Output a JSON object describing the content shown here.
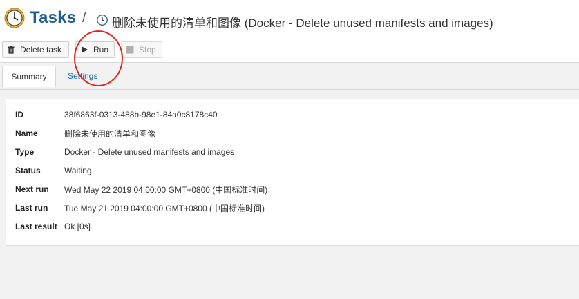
{
  "header": {
    "app_title": "Tasks",
    "separator": "/",
    "task_title": "删除未使用的清单和图像 (Docker - Delete unused manifests and images)",
    "app_icon": "clock-icon",
    "task_icon": "small-clock-icon"
  },
  "toolbar": {
    "delete_label": "Delete task",
    "run_label": "Run",
    "stop_label": "Stop"
  },
  "tabs": [
    {
      "label": "Summary",
      "active": true
    },
    {
      "label": "Settings",
      "active": false
    }
  ],
  "details": [
    {
      "key": "ID",
      "value": "38f6863f-0313-488b-98e1-84a0c8178c40"
    },
    {
      "key": "Name",
      "value": "删除未使用的清单和图像"
    },
    {
      "key": "Type",
      "value": "Docker - Delete unused manifests and images"
    },
    {
      "key": "Status",
      "value": "Waiting"
    },
    {
      "key": "Next run",
      "value": "Wed May 22 2019 04:00:00 GMT+0800 (中国标准时间)"
    },
    {
      "key": "Last run",
      "value": "Tue May 21 2019 04:00:00 GMT+0800 (中国标准时间)"
    },
    {
      "key": "Last result",
      "value": "Ok [0s]"
    }
  ],
  "colors": {
    "title": "#1e5f8f",
    "link": "#1e6ea6",
    "annotation": "#e0241c"
  }
}
